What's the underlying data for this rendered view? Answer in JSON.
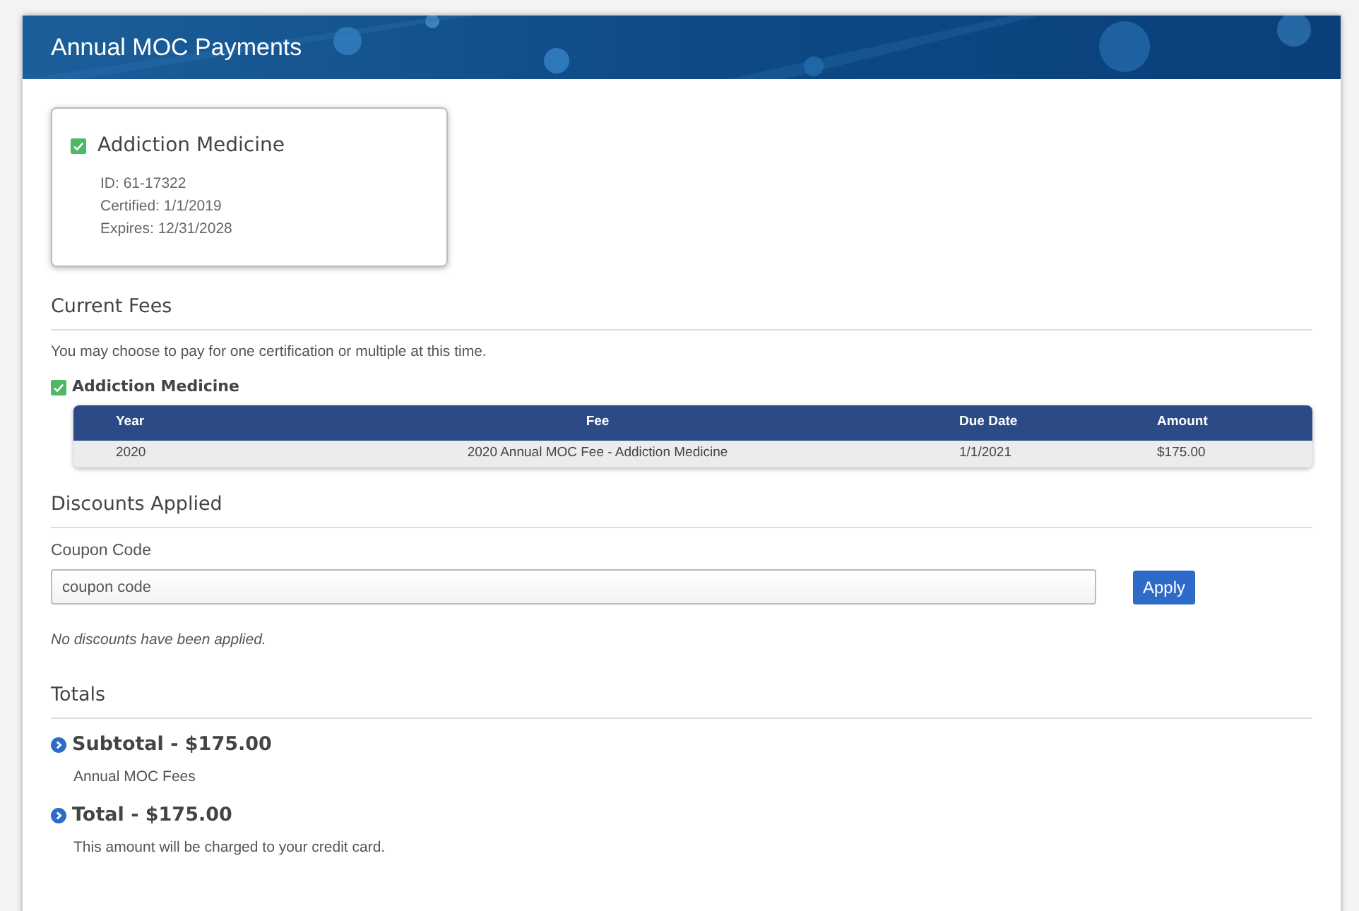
{
  "header": {
    "title": "Annual MOC Payments"
  },
  "certification_card": {
    "name": "Addiction Medicine",
    "checked": true,
    "details": [
      "ID: 61-17322",
      "Certified: 1/1/2019",
      "Expires: 12/31/2028"
    ]
  },
  "current_fees": {
    "heading": "Current Fees",
    "intro": "You may choose to pay for one certification or multiple at this time.",
    "groups": [
      {
        "name": "Addiction Medicine",
        "checked": true,
        "table": {
          "columns": [
            "Year",
            "Fee",
            "Due Date",
            "Amount"
          ],
          "rows": [
            [
              "2020",
              "2020 Annual MOC Fee - Addiction Medicine",
              "1/1/2021",
              "$175.00"
            ]
          ]
        }
      }
    ]
  },
  "discounts": {
    "heading": "Discounts Applied",
    "coupon": {
      "label": "Coupon Code",
      "placeholder": "coupon code"
    },
    "button": "Apply",
    "note": "No discounts have been applied."
  },
  "totals": {
    "heading": "Totals",
    "items": [
      {
        "title": "Subtotal - $175.00",
        "description": "Annual MOC Fees"
      },
      {
        "title": "Total - $175.00",
        "description": "This amount will be charged to your credit card."
      }
    ]
  }
}
